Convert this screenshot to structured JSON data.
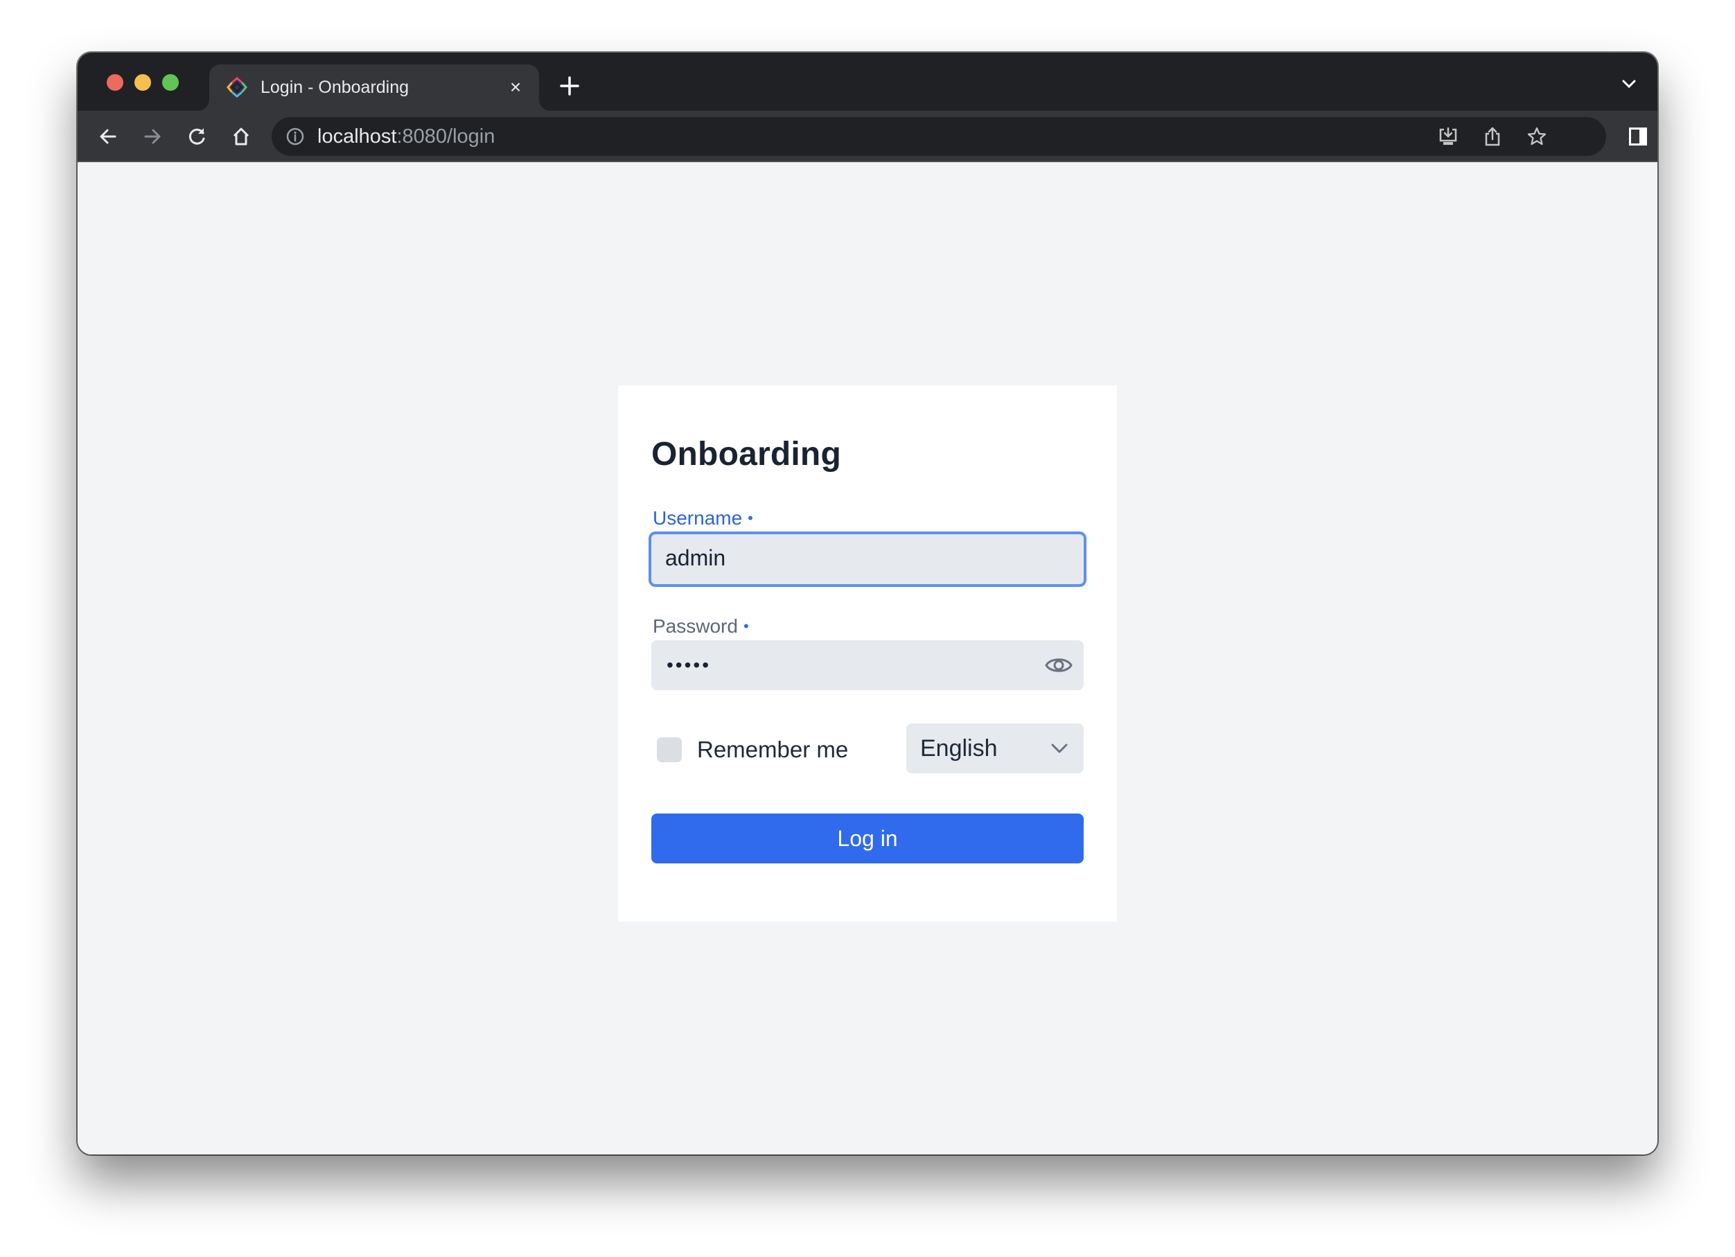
{
  "browser": {
    "tab": {
      "title": "Login - Onboarding",
      "favicon": "vaadin-diamond-icon",
      "close_symbol": "×"
    },
    "new_tab_icon": "plus-icon",
    "tab_search_icon": "chevron-down-icon",
    "toolbar": {
      "back_icon": "arrow-left-icon",
      "forward_icon": "arrow-right-icon",
      "reload_icon": "reload-icon",
      "home_icon": "home-icon"
    },
    "address_bar": {
      "security_icon": "info-icon",
      "host": "localhost",
      "rest": ":8080/login"
    },
    "omnibox_actions": [
      "install-app-icon",
      "share-icon",
      "bookmark-star-icon"
    ],
    "extras": [
      "side-panel-icon",
      "profile-icon",
      "menu-kebab-icon"
    ]
  },
  "login": {
    "title": "Onboarding",
    "username": {
      "label": "Username",
      "required_marker": "•",
      "value": "admin"
    },
    "password": {
      "label": "Password",
      "required_marker": "•",
      "masked_value": "•••••",
      "toggle_icon": "eye-icon"
    },
    "remember_me": {
      "label": "Remember me",
      "checked": false
    },
    "language": {
      "selected": "English"
    },
    "submit_label": "Log in"
  },
  "colors": {
    "primary": "#2f6bec",
    "focus_ring": "#5e8ff0",
    "label_active": "#2b63d9",
    "page_bg": "#f3f4f6",
    "title_text": "#1a2233"
  },
  "dev_badge": {
    "icon": "vaadin-logo-icon",
    "status_colors": [
      "#5bbf5e",
      "#f0c04a"
    ]
  }
}
